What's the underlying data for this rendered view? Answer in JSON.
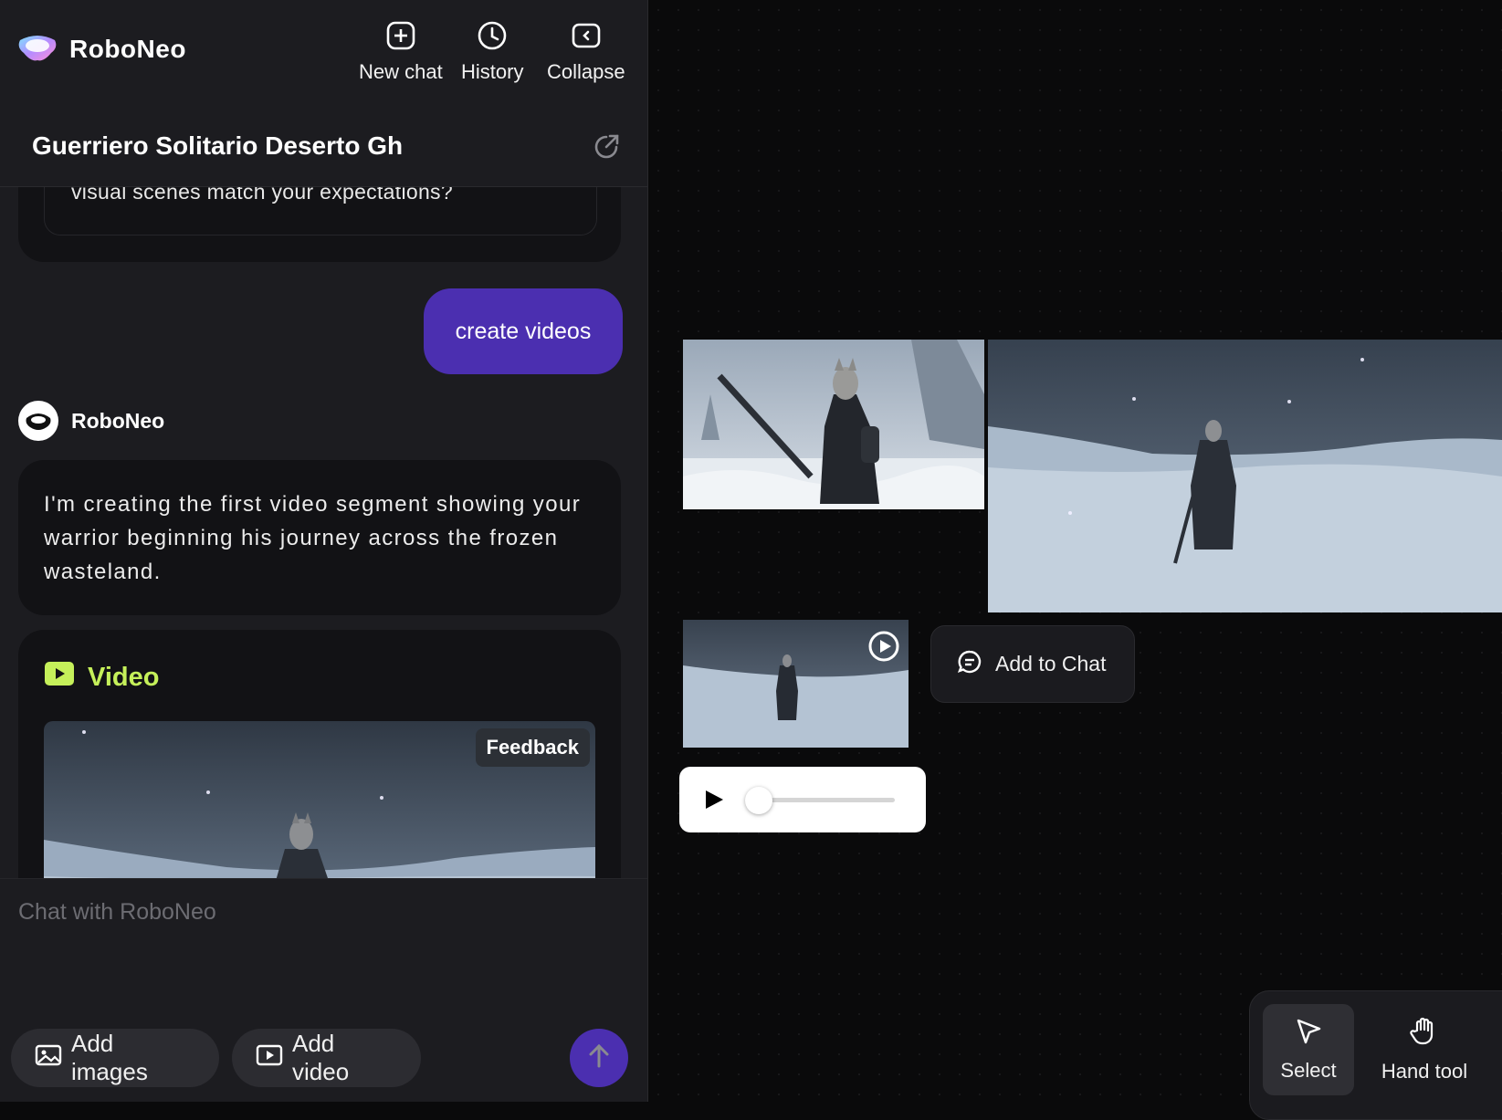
{
  "app": {
    "brand": "RoboNeo"
  },
  "header": {
    "new_chat": "New chat",
    "history": "History",
    "collapse": "Collapse",
    "chat_title": "Guerriero Solitario Deserto Gh"
  },
  "messages": {
    "previous_ai_tail": "visual scenes match your expectations?",
    "user_message": "create videos",
    "bot_name": "RoboNeo",
    "bot_message": "I'm creating the first video segment showing your warrior beginning his journey across the frozen wasteland.",
    "video_label": "Video",
    "feedback": "Feedback"
  },
  "composer": {
    "placeholder": "Chat with RoboNeo",
    "add_images": "Add images",
    "add_video": "Add video"
  },
  "canvas": {
    "add_to_chat": "Add to Chat",
    "player_progress": 0.02
  },
  "toolbar": {
    "select": "Select",
    "hand_tool": "Hand tool"
  },
  "colors": {
    "accent_purple": "#4b2fb0",
    "video_green": "#c5f05a",
    "panel_bg": "#1c1c20",
    "canvas_bg": "#0a0a0b"
  },
  "icons": [
    "roboneo-logo-icon",
    "new-chat-icon",
    "history-icon",
    "collapse-icon",
    "share-icon",
    "bot-avatar-icon",
    "video-icon",
    "play-circle-icon",
    "add-to-chat-icon",
    "image-icon",
    "video-add-icon",
    "arrow-up-icon",
    "cursor-icon",
    "hand-icon",
    "play-icon"
  ]
}
